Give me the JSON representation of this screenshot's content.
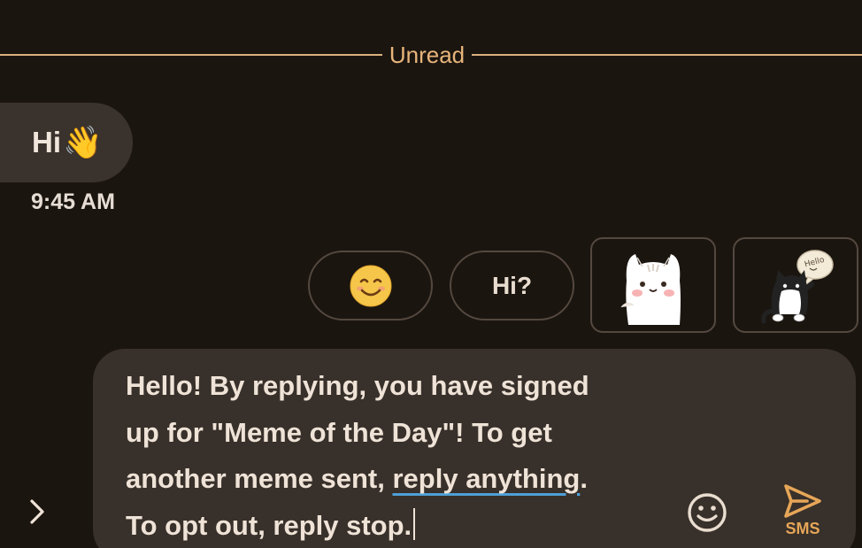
{
  "divider": {
    "label": "Unread"
  },
  "incoming": {
    "text": "Hi",
    "emoji": "👋",
    "time": "9:45 AM"
  },
  "smart_replies": {
    "emoji_icon": "smiling-face-icon",
    "text_reply": "Hi?",
    "stickers": [
      {
        "icon": "white-cat-sticker"
      },
      {
        "icon": "tuxedo-cat-hello-sticker",
        "caption": "Hello"
      }
    ]
  },
  "compose": {
    "text_before_link": "Hello! By replying, you have signed\nup for \"Meme of the Day\"! To get\nanother meme sent, ",
    "link_text": "reply anything",
    "text_after_link": ".\nTo opt out, reply stop.",
    "send_label": "SMS"
  },
  "colors": {
    "background": "#1b1510",
    "accent": "#e8b57b",
    "bubble": "#3a322c",
    "compose": "#38302a",
    "link_underline": "#4ea0d6",
    "send": "#e6a658"
  }
}
